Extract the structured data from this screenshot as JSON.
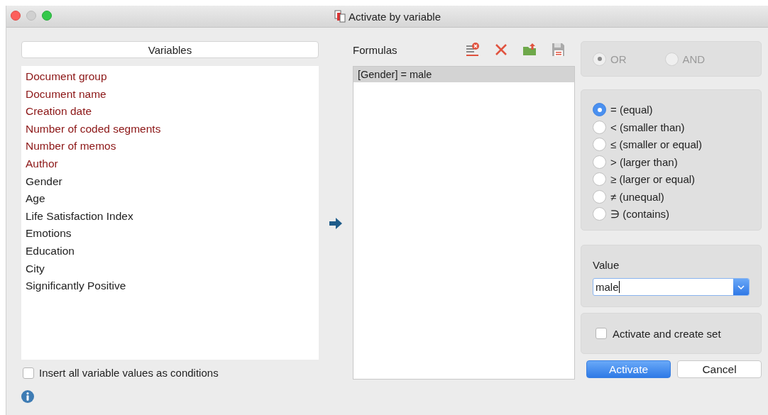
{
  "window": {
    "title": "Activate by variable"
  },
  "variables": {
    "header": "Variables",
    "items": [
      {
        "label": "Document group",
        "kind": "system",
        "selected": false
      },
      {
        "label": "Document name",
        "kind": "system",
        "selected": false
      },
      {
        "label": "Creation date",
        "kind": "system",
        "selected": false
      },
      {
        "label": "Number of coded segments",
        "kind": "system",
        "selected": false
      },
      {
        "label": "Number of memos",
        "kind": "system",
        "selected": false
      },
      {
        "label": "Author",
        "kind": "system",
        "selected": false
      },
      {
        "label": "Gender",
        "kind": "user",
        "selected": false
      },
      {
        "label": "Age",
        "kind": "user",
        "selected": false
      },
      {
        "label": "Life Satisfaction Index",
        "kind": "user",
        "selected": false
      },
      {
        "label": "Emotions",
        "kind": "user",
        "selected": false
      },
      {
        "label": "Education",
        "kind": "user",
        "selected": false
      },
      {
        "label": "City",
        "kind": "user",
        "selected": false
      },
      {
        "label": "Significantly Positive",
        "kind": "user",
        "selected": false
      }
    ]
  },
  "insert_all": {
    "label": "Insert all variable values as conditions",
    "checked": false
  },
  "formulas": {
    "label": "Formulas",
    "items": [
      {
        "text": "[Gender] = male",
        "selected": true
      }
    ]
  },
  "logic": {
    "disabled": true,
    "options": [
      {
        "label": "OR",
        "selected": true
      },
      {
        "label": "AND",
        "selected": false
      }
    ]
  },
  "operators": [
    {
      "label": "= (equal)",
      "selected": true
    },
    {
      "label": "< (smaller than)",
      "selected": false
    },
    {
      "label": "≤ (smaller or equal)",
      "selected": false
    },
    {
      "label": "> (larger than)",
      "selected": false
    },
    {
      "label": "≥ (larger or equal)",
      "selected": false
    },
    {
      "label": "≠ (unequal)",
      "selected": false
    },
    {
      "label": "∋ (contains)",
      "selected": false
    }
  ],
  "value": {
    "label": "Value",
    "value": "male"
  },
  "create_set": {
    "label": "Activate and create set",
    "checked": false
  },
  "buttons": [
    {
      "label": "Activate",
      "kind": "primary"
    },
    {
      "label": "Cancel",
      "kind": "normal"
    }
  ]
}
